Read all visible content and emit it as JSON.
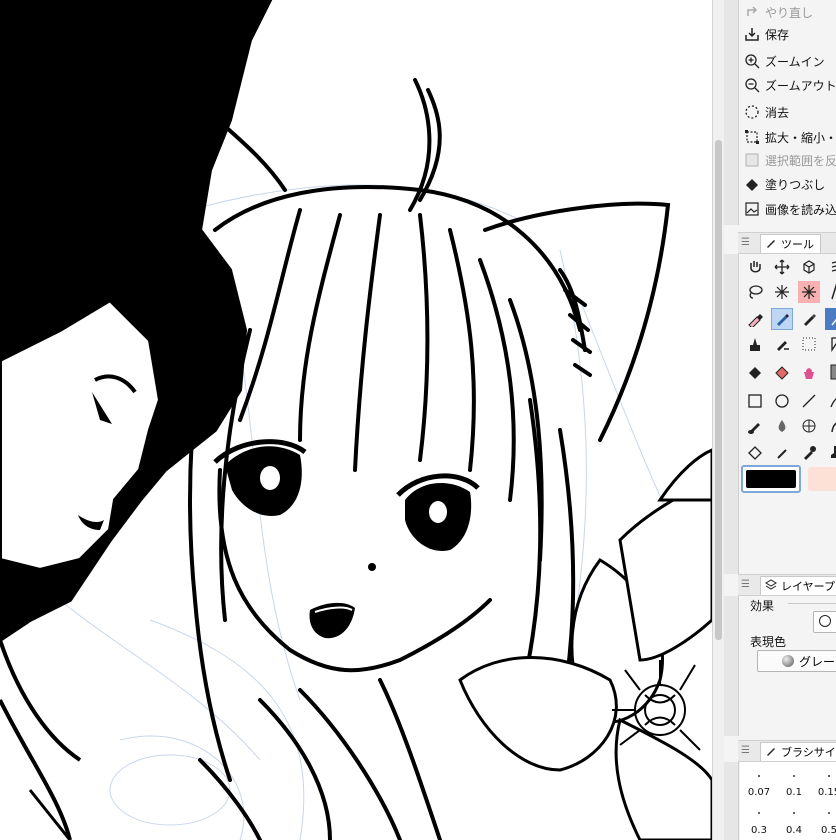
{
  "menu": {
    "redo": "やり直し",
    "save": "保存",
    "zoom_in": "ズームイン",
    "zoom_out": "ズームアウト",
    "clear": "消去",
    "transform": "拡大・縮小・回",
    "selection_border": "選択範囲を反",
    "fill": "塗りつぶし",
    "import_image": "画像を読み込"
  },
  "tool_panel": {
    "tab_label": "ツール"
  },
  "colors": {
    "main": "#000000",
    "sub": "#fde0d6",
    "selection": "#bcd6f3"
  },
  "layer_panel": {
    "tab_label": "レイヤープ",
    "effect_label": "効果",
    "expression_color_label": "表現色",
    "expression_color_value": "グレー"
  },
  "brush_size_panel": {
    "tab_label": "ブラシサイ",
    "sizes": [
      "0.07",
      "0.1",
      "0.15",
      "0.3",
      "0.4",
      "0.5"
    ]
  },
  "icons": [
    "redo-icon",
    "save-icon",
    "zoom-in-icon",
    "zoom-out-icon",
    "clear-icon",
    "transform-icon",
    "selection-icon",
    "fill-icon",
    "import-image-icon",
    "hand-icon",
    "move-icon",
    "object-icon",
    "lasso-icon",
    "sparkle-icon",
    "pen-icon",
    "pencil-icon",
    "brush-icon",
    "eraser-icon",
    "rectangle-icon",
    "ellipse-icon",
    "line-icon"
  ]
}
